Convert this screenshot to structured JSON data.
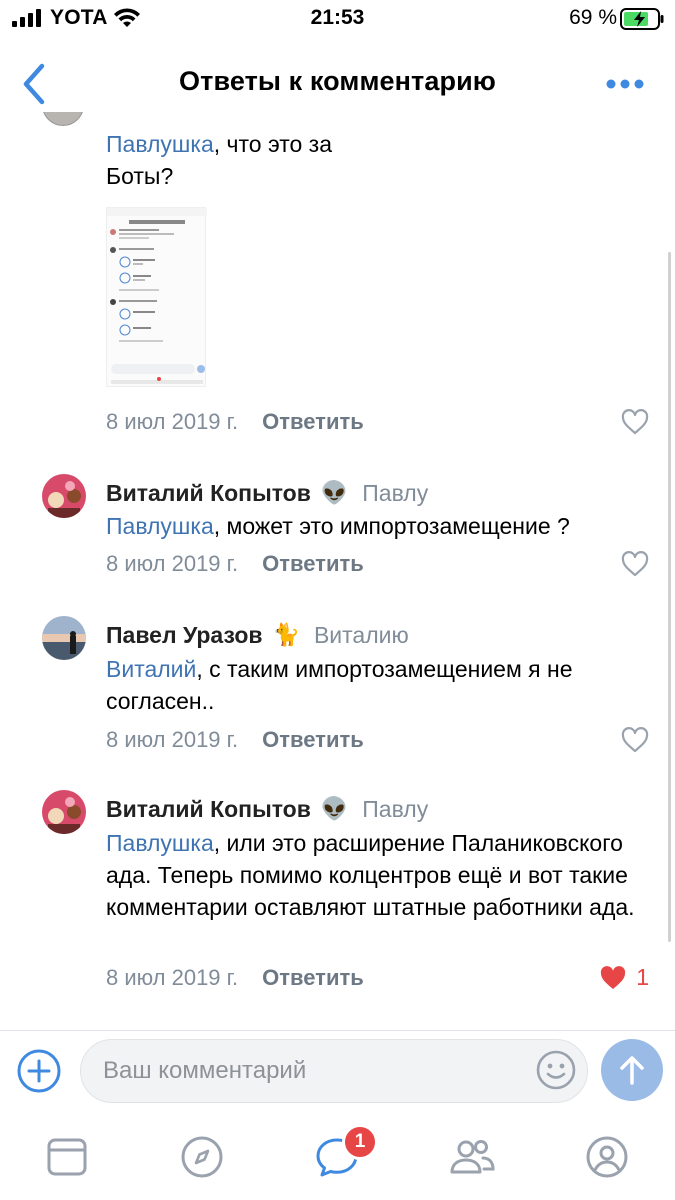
{
  "status_bar": {
    "carrier": "YOTA",
    "time": "21:53",
    "battery_percent": "69 %"
  },
  "nav": {
    "title": "Ответы к комментарию"
  },
  "comments": [
    {
      "mention": "Павлушка",
      "text_line1": ", что это за",
      "text_line2": "Боты?",
      "date": "8 июл 2019 г.",
      "reply_label": "Ответить",
      "liked": false
    },
    {
      "author": "Виталий Копытов",
      "emoji": "👽",
      "reply_to": "Павлу",
      "mention": "Павлушка",
      "text": ", может это импортозамещение ?",
      "date": "8 июл 2019 г.",
      "reply_label": "Ответить",
      "liked": false
    },
    {
      "author": "Павел Уразов",
      "emoji": "🐈",
      "reply_to": "Виталию",
      "mention": "Виталий",
      "text": ", с таким импортозамещением я не согласен..",
      "date": "8 июл 2019 г.",
      "reply_label": "Ответить",
      "liked": false
    },
    {
      "author": "Виталий Копытов",
      "emoji": "👽",
      "reply_to": "Павлу",
      "mention": "Павлушка",
      "text": ", или это расширение Паланиковского ада. Теперь помимо колцентров ещё и вот такие комментарии оставляют штатные работники ада.",
      "date": "8 июл 2019 г.",
      "reply_label": "Ответить",
      "liked": true,
      "like_count": "1"
    }
  ],
  "composer": {
    "placeholder": "Ваш комментарий"
  },
  "tab_bar": {
    "items": [
      "feed-icon",
      "explore-icon",
      "messages-icon",
      "friends-icon",
      "profile-icon"
    ],
    "messages_badge": "1"
  },
  "colors": {
    "accent": "#3f8ae0",
    "link": "#3f74b3",
    "muted": "#818c99",
    "like_red": "#e64646"
  }
}
